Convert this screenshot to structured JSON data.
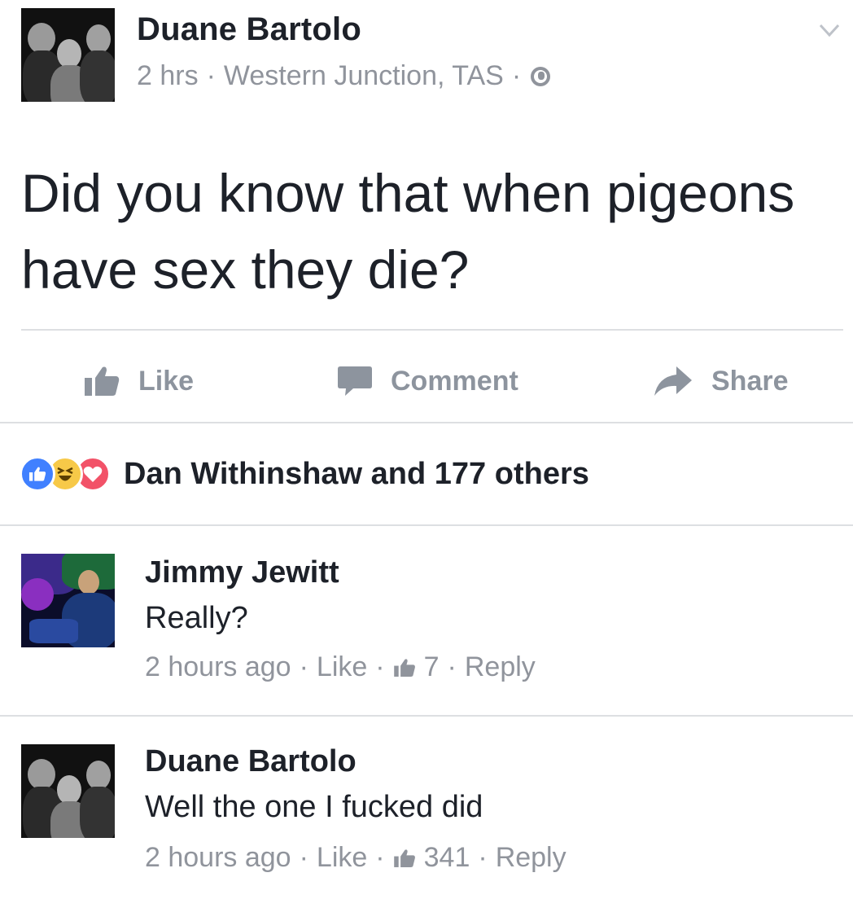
{
  "post": {
    "author": "Duane Bartolo",
    "time": "2 hrs",
    "location": "Western Junction, TAS",
    "meta_sep": "·",
    "privacy_icon": "globe-icon",
    "text": "Did you know that when pigeons have sex they die?"
  },
  "actions": {
    "like": "Like",
    "comment": "Comment",
    "share": "Share"
  },
  "reactions": {
    "icons": [
      "like-reaction-icon",
      "haha-reaction-icon",
      "love-reaction-icon"
    ],
    "summary": "Dan Withinshaw and 177 others"
  },
  "comments": [
    {
      "author": "Jimmy Jewitt",
      "text": "Really?",
      "time": "2 hours ago",
      "like_label": "Like",
      "like_count": "7",
      "reply_label": "Reply"
    },
    {
      "author": "Duane Bartolo",
      "text": "Well the one I fucked did",
      "time": "2 hours ago",
      "like_label": "Like",
      "like_count": "341",
      "reply_label": "Reply"
    }
  ],
  "colors": {
    "meta_gray": "#90949c",
    "action_gray": "#8d949e",
    "like_blue": "#4080ff",
    "haha_yellow": "#f7c948",
    "love_red": "#f25268"
  }
}
